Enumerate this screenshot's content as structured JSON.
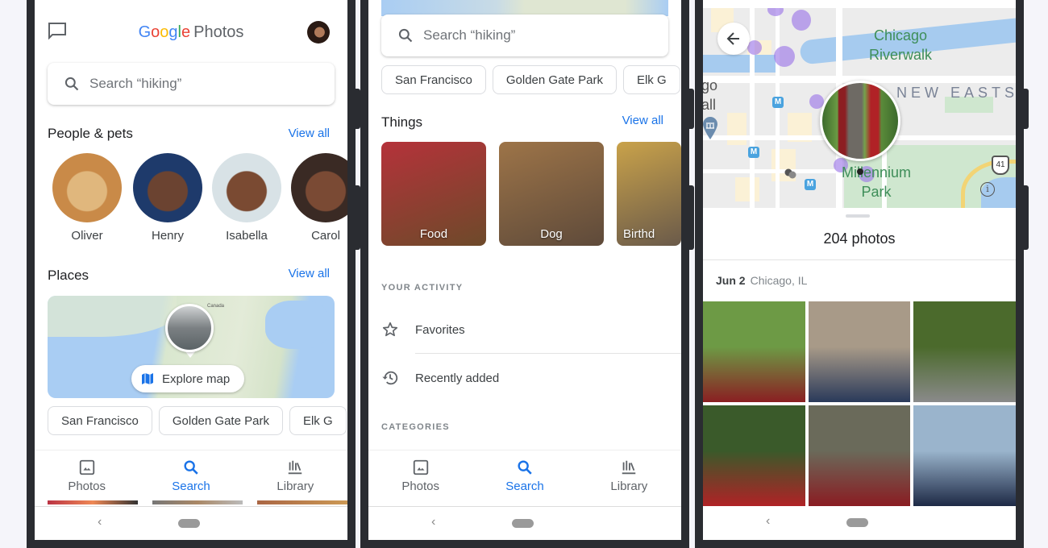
{
  "phone1": {
    "header": {
      "logo_google": [
        "G",
        "o",
        "o",
        "g",
        "l",
        "e"
      ],
      "logo_product": "Photos",
      "message_icon": "message-icon",
      "avatar": "account-avatar"
    },
    "search": {
      "placeholder": "Search “hiking”",
      "icon": "search-icon"
    },
    "people_section": {
      "title": "People & pets",
      "view_all": "View all",
      "people": [
        {
          "name": "Oliver",
          "colors": [
            "#c98a48",
            "#e0b77d"
          ]
        },
        {
          "name": "Henry",
          "colors": [
            "#1e3a6b",
            "#6b4331"
          ]
        },
        {
          "name": "Isabella",
          "colors": [
            "#d8e2e6",
            "#7a4a32"
          ]
        },
        {
          "name": "Carol",
          "colors": [
            "#3a2a24",
            "#7a4a34"
          ]
        }
      ]
    },
    "places_section": {
      "title": "Places",
      "view_all": "View all",
      "map_label": "Canada",
      "explore_button": "Explore map",
      "chips": [
        "San Francisco",
        "Golden Gate Park",
        "Elk G"
      ]
    },
    "bottom_nav": [
      {
        "label": "Photos",
        "icon": "photo-icon",
        "active": false
      },
      {
        "label": "Search",
        "icon": "search-icon",
        "active": true
      },
      {
        "label": "Library",
        "icon": "library-icon",
        "active": false
      }
    ],
    "system_nav": {
      "back": "‹"
    }
  },
  "phone2": {
    "search": {
      "placeholder": "Search “hiking”",
      "icon": "search-icon"
    },
    "chips": [
      "San Francisco",
      "Golden Gate Park",
      "Elk G"
    ],
    "things_section": {
      "title": "Things",
      "view_all": "View all",
      "things": [
        {
          "label": "Food",
          "colors": [
            "#b5323a",
            "#6d4a2a"
          ]
        },
        {
          "label": "Dog",
          "colors": [
            "#9d7448",
            "#5e4a3a"
          ]
        },
        {
          "label": "Birthd",
          "colors": [
            "#c9a24a",
            "#6a5a4a"
          ]
        }
      ]
    },
    "your_activity": {
      "heading": "YOUR ACTIVITY",
      "items": [
        {
          "label": "Favorites",
          "icon": "star-icon"
        },
        {
          "label": "Recently added",
          "icon": "history-icon"
        }
      ]
    },
    "categories_heading": "CATEGORIES",
    "bottom_nav": [
      {
        "label": "Photos",
        "icon": "photo-icon",
        "active": false
      },
      {
        "label": "Search",
        "icon": "search-icon",
        "active": true
      },
      {
        "label": "Library",
        "icon": "library-icon",
        "active": false
      }
    ],
    "system_nav": {
      "back": "‹"
    }
  },
  "phone3": {
    "map": {
      "labels": {
        "riverwalk": "Chicago\nRiverwalk",
        "district": "NEW EASTSI",
        "park": "Millennium\nPark",
        "left_cut": "go\nall",
        "highway": "41",
        "metro": "M",
        "info": "i"
      }
    },
    "photo_count": "204 photos",
    "date": "Jun 2",
    "location": "Chicago, IL",
    "photos": [
      {
        "colors": [
          "#6d9a45",
          "#8a1f22"
        ]
      },
      {
        "colors": [
          "#a89a88",
          "#2a3a5a"
        ]
      },
      {
        "colors": [
          "#4b6a2c",
          "#8a8a8a"
        ]
      },
      {
        "colors": [
          "#3a5a2a",
          "#b02226"
        ]
      },
      {
        "colors": [
          "#6a6a5a",
          "#8a1c22"
        ]
      },
      {
        "colors": [
          "#9ab4cc",
          "#1e2a46"
        ]
      }
    ],
    "system_nav": {
      "back": "‹"
    }
  }
}
